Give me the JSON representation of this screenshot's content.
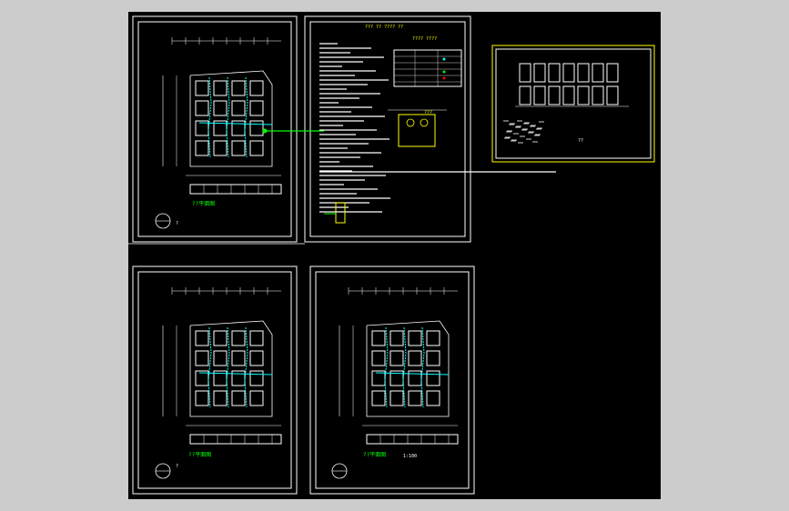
{
  "viewport": {
    "background": "#cccccc",
    "canvas_background": "#000000"
  },
  "colors": {
    "line": "#ffffff",
    "pipe": "#00ffff",
    "label": "#00ff00",
    "highlight": "#ffff00",
    "accent_red": "#ff0000"
  },
  "sheets": [
    {
      "id": "plan-top-left",
      "caption": "??平面图",
      "north_label": "?"
    },
    {
      "id": "notes-sheet",
      "header": "???  ??  ????  ??",
      "table_title": "???? ????",
      "detail_caption": "???"
    },
    {
      "id": "thumbnail",
      "caption": "??"
    },
    {
      "id": "plan-bottom-left",
      "caption": "??平面图",
      "north_label": "?"
    },
    {
      "id": "plan-bottom-right",
      "caption": "??平面图",
      "north_label": "?"
    }
  ],
  "labels": {
    "scale_note": "1:100",
    "dim_label": "??"
  }
}
